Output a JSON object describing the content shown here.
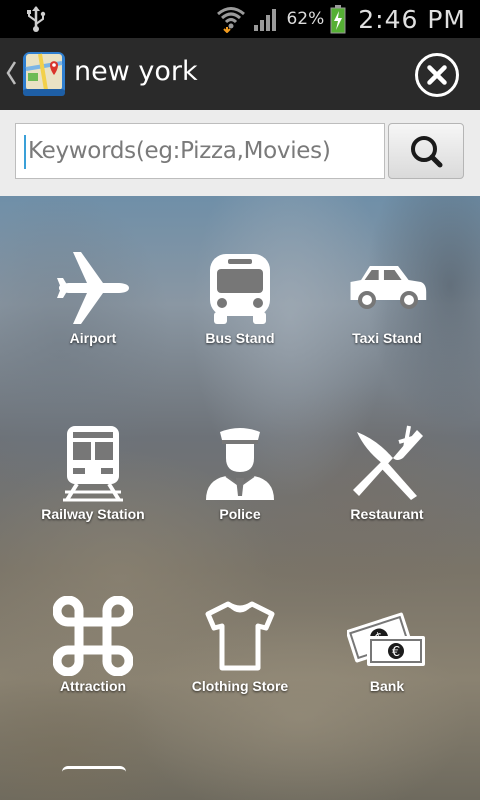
{
  "status_bar": {
    "battery_percent": "62%",
    "time": "2:46 PM"
  },
  "header": {
    "title": "new york"
  },
  "search": {
    "placeholder": "Keywords(eg:Pizza,Movies)"
  },
  "categories": [
    {
      "label": "Airport",
      "icon": "airplane-icon"
    },
    {
      "label": "Bus Stand",
      "icon": "bus-icon"
    },
    {
      "label": "Taxi Stand",
      "icon": "taxi-icon"
    },
    {
      "label": "Railway Station",
      "icon": "train-icon"
    },
    {
      "label": "Police",
      "icon": "police-officer-icon"
    },
    {
      "label": "Restaurant",
      "icon": "fork-knife-icon"
    },
    {
      "label": "Attraction",
      "icon": "command-key-icon"
    },
    {
      "label": "Clothing Store",
      "icon": "tshirt-icon"
    },
    {
      "label": "Bank",
      "icon": "money-bills-icon"
    }
  ],
  "colors": {
    "action_bar": "#2a2a2a",
    "search_bar": "#ececec",
    "cursor": "#3aa0d8"
  }
}
